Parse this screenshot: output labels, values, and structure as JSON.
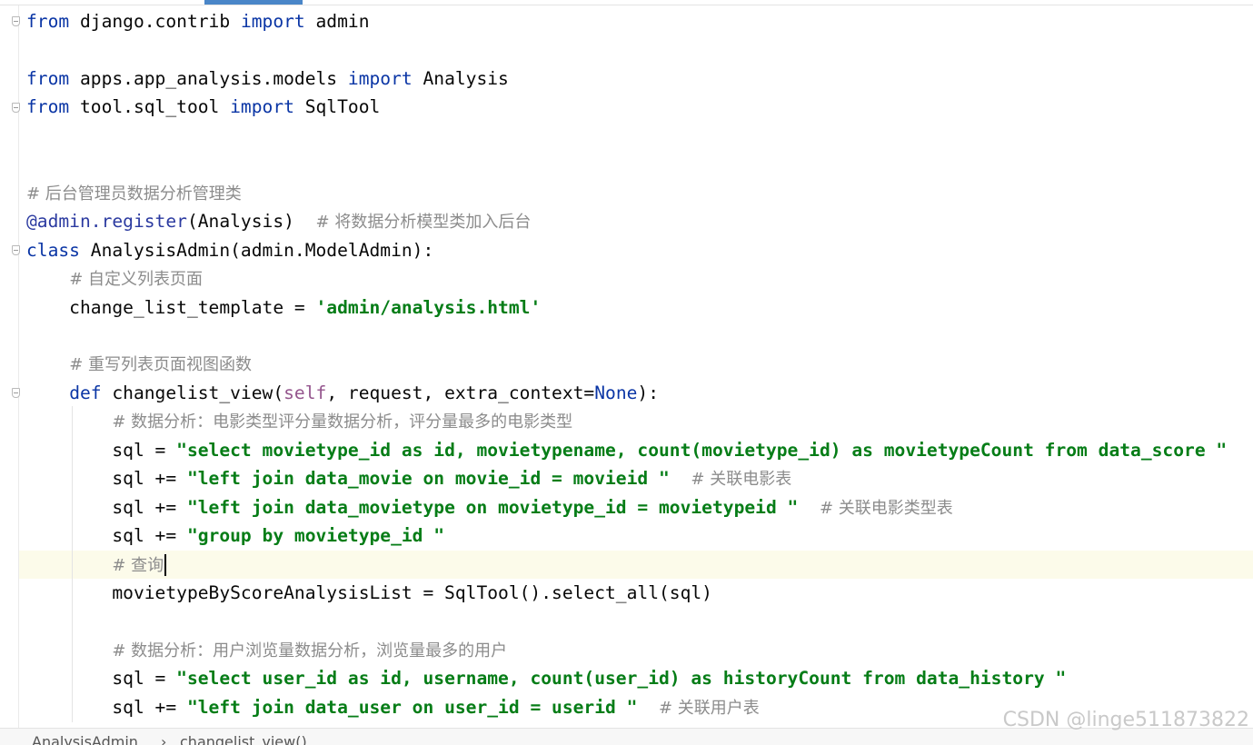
{
  "editor": {
    "lines": [
      {
        "segments": [
          {
            "t": "from",
            "c": "kw"
          },
          {
            "t": " django.contrib "
          },
          {
            "t": "import",
            "c": "kw"
          },
          {
            "t": " admin"
          }
        ]
      },
      {
        "segments": []
      },
      {
        "segments": [
          {
            "t": "from",
            "c": "kw"
          },
          {
            "t": " apps.app_analysis.models "
          },
          {
            "t": "import",
            "c": "kw"
          },
          {
            "t": " Analysis"
          }
        ]
      },
      {
        "segments": [
          {
            "t": "from",
            "c": "kw"
          },
          {
            "t": " tool.sql_tool "
          },
          {
            "t": "import",
            "c": "kw"
          },
          {
            "t": " SqlTool"
          }
        ]
      },
      {
        "segments": []
      },
      {
        "segments": []
      },
      {
        "segments": [
          {
            "t": "# 后台管理员数据分析管理类",
            "c": "cmt"
          }
        ]
      },
      {
        "segments": [
          {
            "t": "@admin.register",
            "c": "deco"
          },
          {
            "t": "(Analysis)  "
          },
          {
            "t": "# 将数据分析模型类加入后台",
            "c": "cmt"
          }
        ]
      },
      {
        "segments": [
          {
            "t": "class",
            "c": "kw"
          },
          {
            "t": " AnalysisAdmin(admin.ModelAdmin):"
          }
        ]
      },
      {
        "segments": [
          {
            "t": "    "
          },
          {
            "t": "# 自定义列表页面",
            "c": "cmt"
          }
        ]
      },
      {
        "segments": [
          {
            "t": "    change_list_template = "
          },
          {
            "t": "'admin/analysis.html'",
            "c": "str"
          }
        ]
      },
      {
        "segments": []
      },
      {
        "segments": [
          {
            "t": "    "
          },
          {
            "t": "# 重写列表页面视图函数",
            "c": "cmt"
          }
        ]
      },
      {
        "segments": [
          {
            "t": "    "
          },
          {
            "t": "def",
            "c": "kw"
          },
          {
            "t": " changelist_view("
          },
          {
            "t": "self",
            "c": "self"
          },
          {
            "t": ", request, extra_context="
          },
          {
            "t": "None",
            "c": "builtin"
          },
          {
            "t": "):"
          }
        ]
      },
      {
        "segments": [
          {
            "t": "        "
          },
          {
            "t": "# 数据分析：电影类型评分量数据分析，评分量最多的电影类型",
            "c": "cmt"
          }
        ]
      },
      {
        "segments": [
          {
            "t": "        sql = "
          },
          {
            "t": "\"select movietype_id as id, movietypename, count(movietype_id) as movietypeCount from data_score \"",
            "c": "str"
          }
        ]
      },
      {
        "segments": [
          {
            "t": "        sql += "
          },
          {
            "t": "\"left join data_movie on movie_id = movieid \"",
            "c": "str"
          },
          {
            "t": "  "
          },
          {
            "t": "# 关联电影表",
            "c": "cmt"
          }
        ]
      },
      {
        "segments": [
          {
            "t": "        sql += "
          },
          {
            "t": "\"left join data_movietype on movietype_id = movietypeid \"",
            "c": "str"
          },
          {
            "t": "  "
          },
          {
            "t": "# 关联电影类型表",
            "c": "cmt"
          }
        ]
      },
      {
        "segments": [
          {
            "t": "        sql += "
          },
          {
            "t": "\"group by movietype_id \"",
            "c": "str"
          }
        ]
      },
      {
        "segments": [
          {
            "t": "        "
          },
          {
            "t": "# 查询",
            "c": "cmt"
          }
        ],
        "caret": true
      },
      {
        "segments": [
          {
            "t": "        movietypeByScoreAnalysisList = SqlTool().select_all(sql)"
          }
        ]
      },
      {
        "segments": []
      },
      {
        "segments": [
          {
            "t": "        "
          },
          {
            "t": "# 数据分析：用户浏览量数据分析，浏览量最多的用户",
            "c": "cmt"
          }
        ]
      },
      {
        "segments": [
          {
            "t": "        sql = "
          },
          {
            "t": "\"select user_id as id, username, count(user_id) as historyCount from data_history \"",
            "c": "str"
          }
        ]
      },
      {
        "segments": [
          {
            "t": "        sql += "
          },
          {
            "t": "\"left join data_user on user_id = userid \"",
            "c": "str"
          },
          {
            "t": "  "
          },
          {
            "t": "# 关联用户表",
            "c": "cmt"
          }
        ]
      }
    ]
  },
  "breadcrumb": {
    "items": [
      "AnalysisAdmin",
      "›",
      "changelist_view()"
    ]
  },
  "watermark": "CSDN @linge511873822",
  "colors": {
    "keyword": "#0a35a5",
    "string": "#067d17",
    "comment": "#8c8c8c",
    "decorator": "#2b3aa0",
    "self": "#94558d",
    "caret_line": "#fcfbea"
  }
}
